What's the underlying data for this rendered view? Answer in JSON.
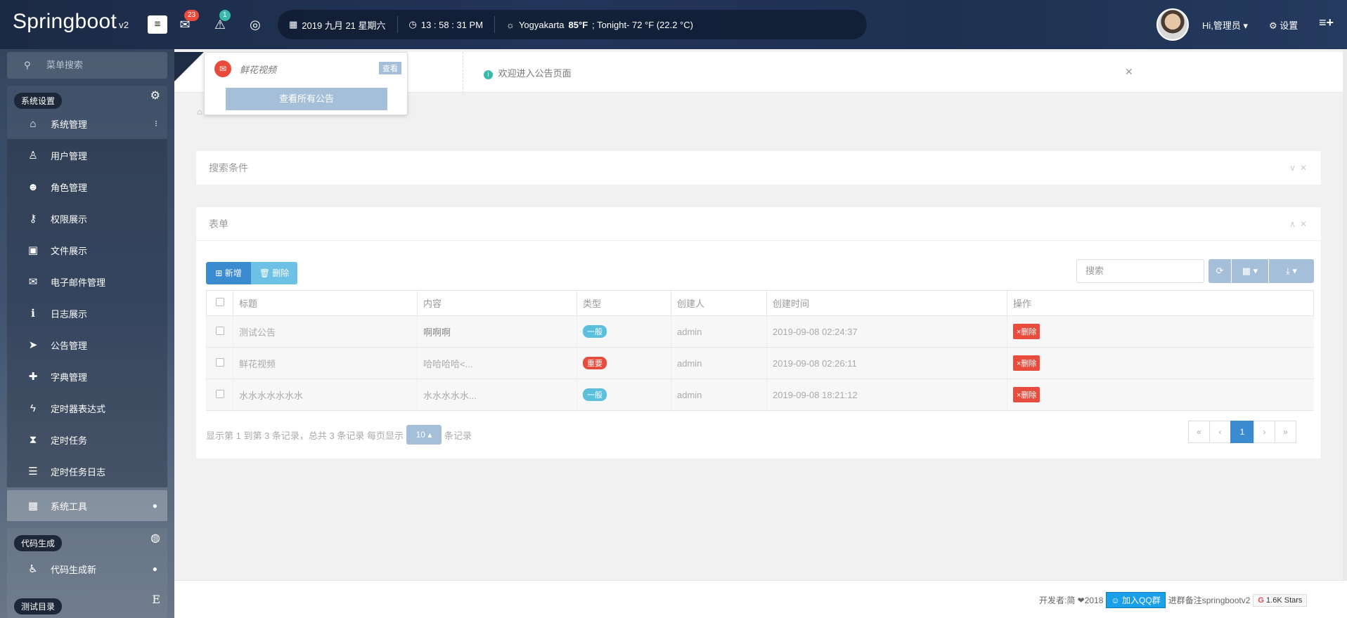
{
  "header": {
    "brand": "Springboot",
    "brand_version": "v2",
    "messages_count": "23",
    "alerts_count": "1",
    "date": "2019 九月 21 星期六",
    "time": "13 : 58 : 31 PM",
    "weather_city": "Yogyakarta",
    "weather_temp": "85°F",
    "weather_tonight": "; Tonight- 72 °F (22.2 °C)",
    "user_greeting": "Hi,管理员",
    "settings_label": "设置"
  },
  "sidebar": {
    "search_placeholder": "菜单搜索",
    "groups": [
      {
        "title": "系统设置"
      },
      {
        "title": "代码生成"
      },
      {
        "title": "测试目录"
      }
    ],
    "system_management": "系统管理",
    "items": [
      {
        "label": "用户管理",
        "icon": "user-icon"
      },
      {
        "label": "角色管理",
        "icon": "users-icon"
      },
      {
        "label": "权限展示",
        "icon": "key-icon"
      },
      {
        "label": "文件展示",
        "icon": "image-icon"
      },
      {
        "label": "电子邮件管理",
        "icon": "envelope-icon"
      },
      {
        "label": "日志展示",
        "icon": "info-icon"
      },
      {
        "label": "公告管理",
        "icon": "send-icon"
      },
      {
        "label": "字典管理",
        "icon": "puzzle-icon"
      },
      {
        "label": "定时器表达式",
        "icon": "bolt-icon"
      },
      {
        "label": "定时任务",
        "icon": "hourglass-icon"
      },
      {
        "label": "定时任务日志",
        "icon": "database-icon"
      }
    ],
    "system_tools": "系统工具",
    "code_gen_new": "代码生成新"
  },
  "tabbar": {
    "welcome": "欢迎进入公告页面"
  },
  "search_panel": {
    "title": "搜索条件"
  },
  "table_panel": {
    "title": "表单",
    "add_label": "新增",
    "delete_label": "删除",
    "search_placeholder": "搜索",
    "columns": [
      "标题",
      "内容",
      "类型",
      "创建人",
      "创建时间",
      "操作"
    ],
    "rows": [
      {
        "title": "测试公告",
        "content": "啊啊啊",
        "type": "一般",
        "type_color": "#5bc0de",
        "creator": "admin",
        "created": "2019-09-08 02:24:37",
        "action": "×删除"
      },
      {
        "title": "鲜花视频",
        "content": "哈哈哈哈<...",
        "type": "重要",
        "type_color": "#e74c3c",
        "creator": "admin",
        "created": "2019-09-08 02:26:11",
        "action": "×删除"
      },
      {
        "title": "水水水水水水水",
        "content": "水水水水水...",
        "type": "一般",
        "type_color": "#5bc0de",
        "creator": "admin",
        "created": "2019-09-08 18:21:12",
        "action": "×删除"
      }
    ],
    "page_info_prefix": "显示第 1 到第 3 条记录，总共 3 条记录 每页显示",
    "page_size": "10",
    "page_info_suffix": "条记录",
    "pager": [
      "«",
      "‹",
      "1",
      "›",
      "»"
    ]
  },
  "dropdown": {
    "item_title": "鲜花视频",
    "view_label": "查看",
    "all_label": "查看所有公告"
  },
  "footer": {
    "dev_text": "开发者:简 ❤2018",
    "qq_label": "加入QQ群",
    "note": "进群备注springbootv2",
    "stars": "1.6K Stars"
  },
  "colors": {
    "primary": "#3b8bd1",
    "danger": "#e74c3c",
    "info": "#5bc0de"
  }
}
